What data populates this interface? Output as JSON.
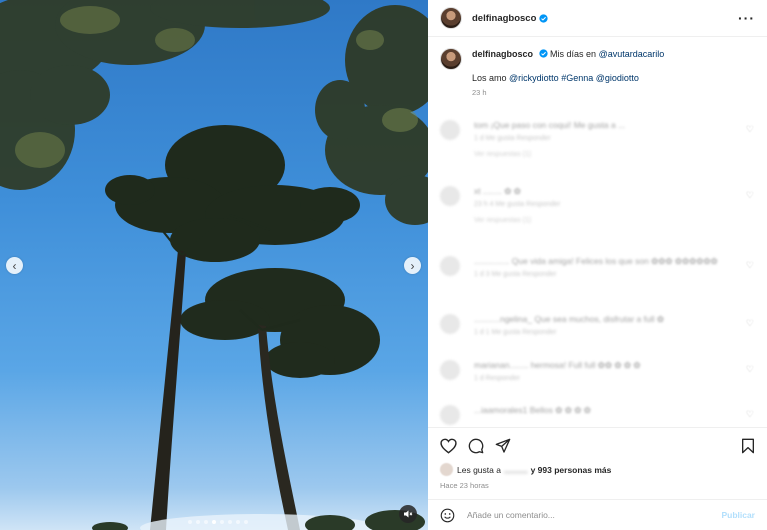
{
  "post": {
    "author": "delfinagbosco",
    "verified": true,
    "more_icon": "more-horizontal-icon"
  },
  "caption": {
    "author": "delfinagbosco",
    "text_prefix": "Mis días en ",
    "mention_location": "@avutardacarilo",
    "line2_prefix": "Los amo ",
    "mention1": "@rickydiotto",
    "hashtag": "#Genna",
    "mention2": "@giodiotto",
    "time": "23 h"
  },
  "comments": [
    {
      "text": "tom  ¡Que paso con coqui!  Me gusta a ...",
      "meta": "1 d   Me gusta   Responder",
      "replies": "Ver respuestas (1)"
    },
    {
      "text": "xt ........ ✿ ✿",
      "meta": "23 h   4 Me gusta   Responder",
      "replies": "Ver respuestas (1)"
    },
    {
      "text": "...............  Que vida amiga! Felices los que son ✿✿✿ ✿✿✿✿✿✿",
      "meta": "1 d   3 Me gusta   Responder",
      "replies": ""
    },
    {
      "text": "...........ngelina_  Que sea muchos, disfrutar a full ✿",
      "meta": "1 d   1 Me gusta   Responder",
      "replies": ""
    },
    {
      "text": "marianan........  hermosa! Full full  ✿✿ ✿ ✿ ✿",
      "meta": "1 d   Responder",
      "replies": ""
    },
    {
      "text": "...iaamorales1  Bellos ✿ ✿ ✿ ✿",
      "meta": "",
      "replies": ""
    }
  ],
  "actions": {
    "like_icon": "heart-icon",
    "comment_icon": "comment-icon",
    "share_icon": "send-icon",
    "save_icon": "bookmark-icon"
  },
  "likes": {
    "prefix": "Les gusta a",
    "hidden_user": "..........",
    "suffix": "y 993 personas más"
  },
  "since": "Hace 23 horas",
  "comment_box": {
    "emoji_icon": "emoji-icon",
    "placeholder": "Añade un comentario...",
    "publish_label": "Publicar"
  },
  "carousel": {
    "prev_icon": "chevron-left-icon",
    "next_icon": "chevron-right-icon",
    "slides": 8,
    "active_slide": 4,
    "mute_icon": "speaker-muted-icon"
  },
  "colors": {
    "sky": "#3f8fd9",
    "verified": "#0095f6",
    "link": "#00376b",
    "publish": "#b2dffc"
  }
}
